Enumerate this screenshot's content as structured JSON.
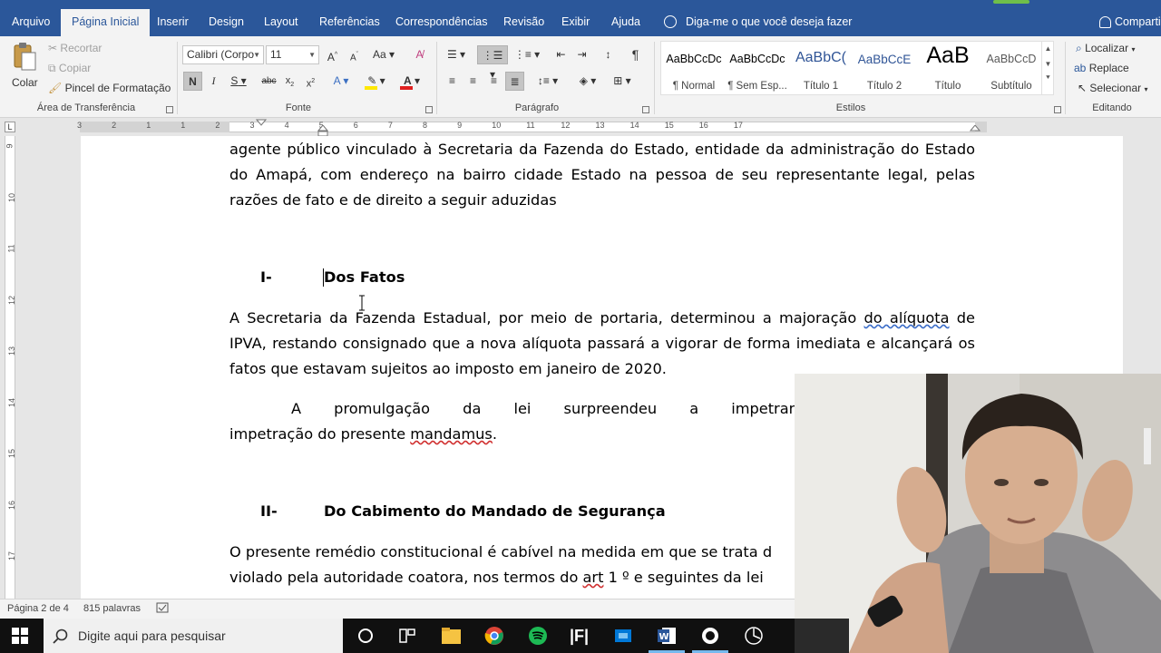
{
  "tabs": {
    "arquivo": "Arquivo",
    "inicial": "Página Inicial",
    "inserir": "Inserir",
    "design": "Design",
    "layout": "Layout",
    "referencias": "Referências",
    "correspondencias": "Correspondências",
    "revisao": "Revisão",
    "exibir": "Exibir",
    "ajuda": "Ajuda",
    "tell_me": "Diga-me o que você deseja fazer",
    "share": "Comparti"
  },
  "clipboard": {
    "paste": "Colar",
    "cut": "Recortar",
    "copy": "Copiar",
    "format_painter": "Pincel de Formatação",
    "label": "Área de Transferência"
  },
  "font": {
    "name": "Calibri (Corpo",
    "size": "11",
    "label": "Fonte",
    "bold": "N",
    "italic": "I",
    "underline": "S"
  },
  "paragraph": {
    "label": "Parágrafo"
  },
  "styles": {
    "label": "Estilos",
    "items": [
      {
        "preview": "AaBbCcDc",
        "name": "¶ Normal"
      },
      {
        "preview": "AaBbCcDc",
        "name": "¶ Sem Esp..."
      },
      {
        "preview": "AaBbC(",
        "name": "Título 1"
      },
      {
        "preview": "AaBbCcE",
        "name": "Título 2"
      },
      {
        "preview": "AaB",
        "name": "Título"
      },
      {
        "preview": "AaBbCcD",
        "name": "Subtítulo"
      }
    ]
  },
  "editing": {
    "find": "Localizar",
    "replace": "Replace",
    "select": "Selecionar",
    "label": "Editando"
  },
  "ruler": {
    "h_numbers": [
      "3",
      "2",
      "1",
      "1",
      "2",
      "3",
      "4",
      "5",
      "6",
      "7",
      "8",
      "9",
      "10",
      "11",
      "12",
      "13",
      "14",
      "15",
      "16",
      "17"
    ],
    "v_numbers": [
      "9",
      "10",
      "11",
      "12",
      "13",
      "14",
      "15",
      "16",
      "17"
    ]
  },
  "document": {
    "para1": "agente público vinculado à Secretaria da Fazenda do Estado, entidade da administração do Estado do Amapá, com endereço na bairro cidade Estado na pessoa de seu representante legal, pelas razões de fato e de direito a seguir aduzidas",
    "h1_num": "I-",
    "h1_text": "Dos Fatos",
    "para2_a": "A Secretaria da Fazenda Estadual, por meio de portaria, determinou a majoração ",
    "para2_sq": "do alíquota",
    "para2_b": " de IPVA, restando consignado que a nova alíquota passará a vigorar de forma imediata e alcançará os fatos que estavam sujeitos ao imposto em janeiro de 2020.",
    "para3_a": "A promulgação da lei surpreendeu a impetrante, não restando",
    "para3_b": "impetração do presente ",
    "para3_sq": "mandamus",
    "para3_c": ".",
    "h2_num": "II-",
    "h2_text": "Do Cabimento do Mandado de Segurança",
    "para4_line1": "O presente remédio constitucional é cabível na medida em que se trata d",
    "para4_line2_a": "violado pela autoridade coatora, nos termos do ",
    "para4_line2_sq": "art",
    "para4_line2_b": " 1 º e seguintes da lei"
  },
  "status": {
    "page": "Página 2 de 4",
    "words": "815 palavras"
  },
  "taskbar": {
    "search_placeholder": "Digite aqui para pesquisar"
  },
  "colors": {
    "brand": "#2b579a",
    "ribbon_bg": "#f3f3f3",
    "font_color_bar": "#e02020",
    "highlight_bar": "#ffe800"
  }
}
